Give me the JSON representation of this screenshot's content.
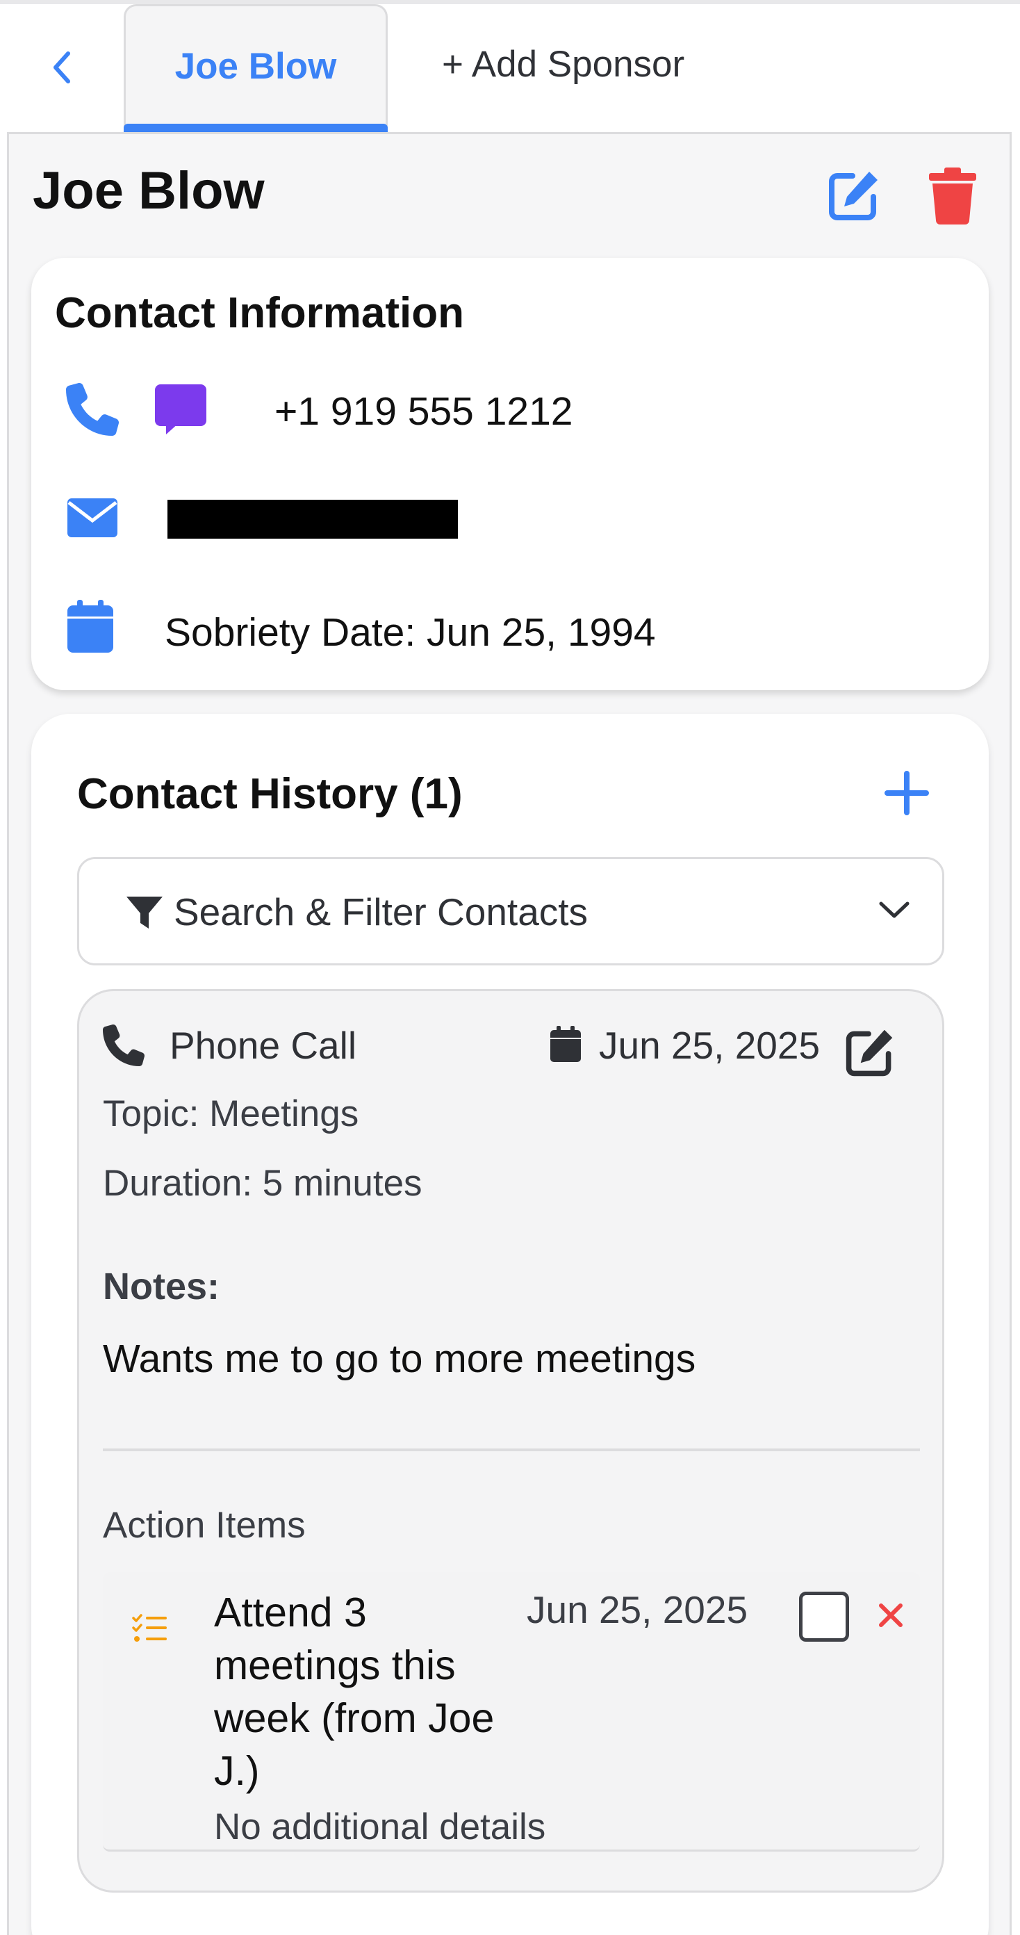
{
  "tabs": {
    "active_label": "Joe Blow",
    "add_label": "+ Add Sponsor"
  },
  "sponsor": {
    "name": "Joe Blow"
  },
  "contact_info": {
    "title": "Contact Information",
    "phone": "+1 919 555 1212",
    "sobriety": "Sobriety Date: Jun 25, 1994"
  },
  "history": {
    "title": "Contact History (1)",
    "filter_label": "Search & Filter Contacts",
    "entries": [
      {
        "type": "Phone Call",
        "date": "Jun 25, 2025",
        "topic": "Topic: Meetings",
        "duration": "Duration: 5 minutes",
        "notes_label": "Notes:",
        "notes": "Wants me to go to more meetings",
        "action_items_title": "Action Items",
        "action_items": [
          {
            "title": "Attend 3 meetings this week (from Joe J.)",
            "date": "Jun 25, 2025",
            "details": "No additional details",
            "completed": false
          }
        ]
      }
    ]
  },
  "colors": {
    "accent": "#3b82f6",
    "danger": "#ef4444",
    "message": "#7c3aed",
    "action_icon": "#f59e0b"
  },
  "icons": [
    "chevron-left-icon",
    "edit-icon",
    "trash-icon",
    "phone-icon",
    "message-icon",
    "email-icon",
    "calendar-icon",
    "plus-icon",
    "filter-icon",
    "chevron-down-icon",
    "list-check-icon",
    "close-icon"
  ]
}
